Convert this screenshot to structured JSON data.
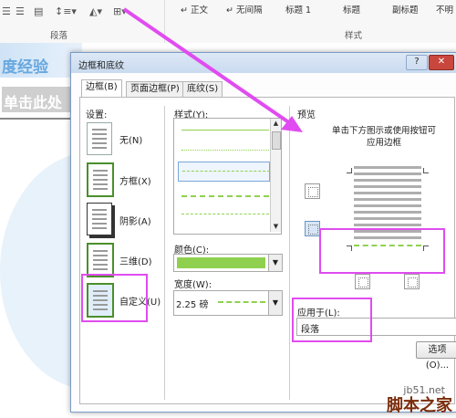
{
  "ribbon": {
    "para_group_label": "段落",
    "styles_group_label": "样式",
    "styles": [
      "正文",
      "无间隔",
      "标题 1",
      "标题",
      "副标题",
      "不明"
    ]
  },
  "document": {
    "heading_text": "度经验",
    "placeholder_text": "单击此处"
  },
  "dialog": {
    "title": "边框和底纹",
    "help_btn": "?",
    "close_btn": "✕",
    "tabs": [
      "边框(B)",
      "页面边框(P)",
      "底纹(S)"
    ],
    "settings_label": "设置:",
    "settings": [
      "无(N)",
      "方框(X)",
      "阴影(A)",
      "三维(D)",
      "自定义(U)"
    ],
    "style_label": "样式(Y):",
    "color_label": "颜色(C):",
    "color_value": "#8fd14f",
    "width_label": "宽度(W):",
    "width_value": "2.25 磅",
    "preview_label": "预览",
    "preview_hint": "单击下方图示或使用按钮可应用边框",
    "apply_label": "应用于(L):",
    "apply_value": "段落",
    "options_btn": "选项(O)..."
  },
  "watermark": {
    "site": "jb51.net",
    "brand": "脚本之家"
  },
  "colors": {
    "accent_magenta": "#e04cf0",
    "border_green": "#8fd14f"
  }
}
